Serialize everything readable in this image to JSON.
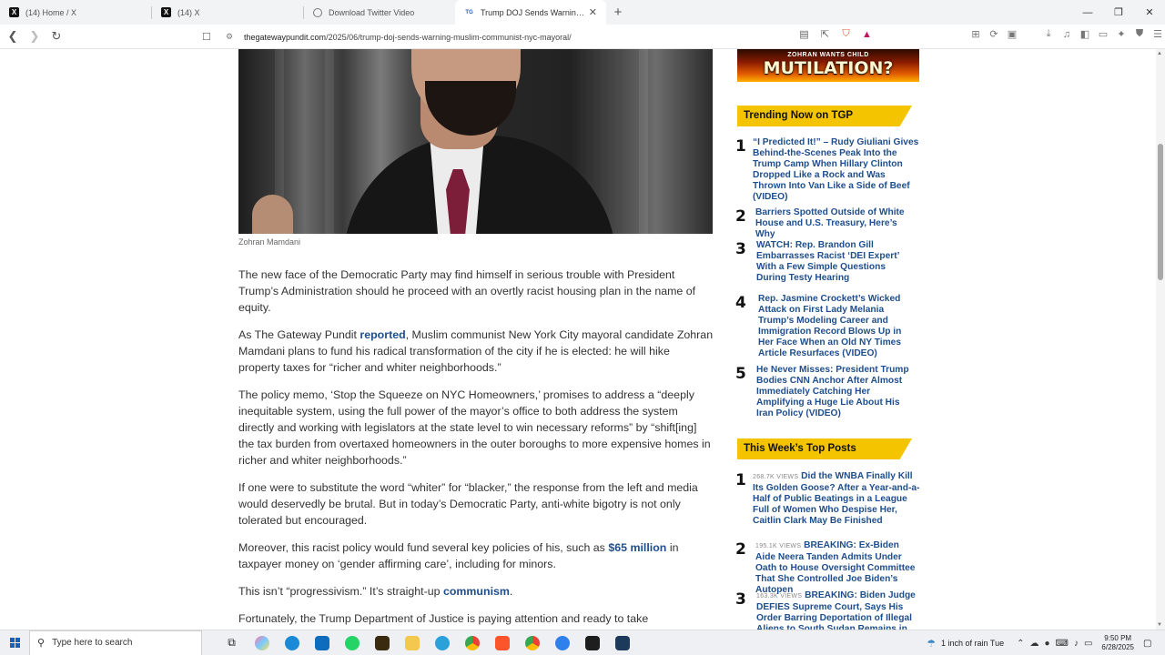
{
  "tabs": [
    {
      "label": "(14) Home / X",
      "icon": "x-logo-icon",
      "fav": "X"
    },
    {
      "label": "(14) X",
      "icon": "x-logo-icon",
      "fav": "X"
    },
    {
      "label": "Download Twitter Video",
      "icon": "globe-icon",
      "fav": ""
    },
    {
      "label": "Trump DOJ Sends Warning to M",
      "icon": "tgp-icon",
      "fav": "ᵀᴳ"
    }
  ],
  "browser": {
    "new_tab": "+",
    "url_domain": "thegatewaypundit.com",
    "url_path": "/2025/06/trump-doj-sends-warning-muslim-communist-nyc-mayoral/"
  },
  "article": {
    "caption": "Zohran Mamdani",
    "p1": "The new face of the Democratic Party may find himself in serious trouble with President Trump’s Administration should he proceed with an overtly racist housing plan in the name of equity.",
    "p2_a": "As The Gateway Pundit ",
    "p2_link": "reported",
    "p2_b": ", Muslim communist New York City mayoral candidate Zohran Mamdani plans to fund his radical transformation of the city if he is elected: he will hike property taxes for “richer and whiter neighborhoods.”",
    "p3": "The policy memo, ‘Stop the Squeeze on NYC Homeowners,’ promises to address a “deeply inequitable system, using the full power of the mayor’s office to both address the system directly and working with legislators at the state level to win necessary reforms” by “shift[ing] the tax burden from overtaxed homeowners in the outer boroughs to more expensive homes in richer and whiter neighborhoods.”",
    "p4": "If one were to substitute the word “whiter” for “blacker,” the response from the left and media would deservedly be brutal. But in today’s Democratic Party, anti-white bigotry is not only tolerated but encouraged.",
    "p5_a": "Moreover, this racist policy would fund several key policies of his, such as ",
    "p5_link": "$65 million",
    "p5_b": " in taxpayer money on ‘gender affirming care’, including for minors.",
    "p6_a": "This isn’t “progressivism.” It’s straight-up ",
    "p6_link": "communism",
    "p6_b": ".",
    "p7": "Fortunately, the Trump Department of Justice is paying attention and ready to take"
  },
  "sidebar": {
    "ad_small": "ZOHRAN WANTS CHILD",
    "ad_big": "MUTILATION?",
    "trending_title": "Trending Now on TGP",
    "trending": [
      {
        "num": "1",
        "text": "“I Predicted It!” – Rudy Giuliani Gives Behind-the-Scenes Peak Into the Trump Camp When Hillary Clinton Dropped Like a Rock and Was Thrown Into Van Like a Side of Beef (VIDEO)"
      },
      {
        "num": "2",
        "text": "Barriers Spotted Outside of White House and U.S. Treasury, Here’s Why"
      },
      {
        "num": "3",
        "text": "WATCH: Rep. Brandon Gill Embarrasses Racist ‘DEI Expert’ With a Few Simple Questions During Testy Hearing"
      },
      {
        "num": "4",
        "text": "Rep. Jasmine Crockett’s Wicked Attack on First Lady Melania Trump’s Modeling Career and Immigration Record Blows Up in Her Face When an Old NY Times Article Resurfaces (VIDEO)"
      },
      {
        "num": "5",
        "text": "He Never Misses: President Trump Bodies CNN Anchor After Almost Immediately Catching Her Amplifying a Huge Lie About His Iran Policy (VIDEO)"
      }
    ],
    "top_title": "This Week’s Top Posts",
    "top": [
      {
        "num": "1",
        "views": "268.7K VIEWS",
        "text": "Did the WNBA Finally Kill Its Golden Goose? After a Year-and-a-Half of Public Beatings in a League Full of Women Who Despise Her, Caitlin Clark May Be Finished"
      },
      {
        "num": "2",
        "views": "195.1K VIEWS",
        "text": "BREAKING: Ex-Biden Aide Neera Tanden Admits Under Oath to House Oversight Committee That She Controlled Joe Biden’s Autopen"
      },
      {
        "num": "3",
        "views": "163.3K VIEWS",
        "text": "BREAKING: Biden Judge DEFIES Supreme Court, Says His Order Barring Deportation of Illegal Aliens to South Sudan Remains in"
      }
    ]
  },
  "taskbar": {
    "search_placeholder": "Type here to search",
    "weather": "1 inch of rain Tue",
    "time": "9:50 PM",
    "date": "6/28/2025"
  },
  "colors": {
    "link": "#1f4e8c",
    "header_yellow": "#f4c400",
    "tab_bar": "#f1f3f4"
  }
}
